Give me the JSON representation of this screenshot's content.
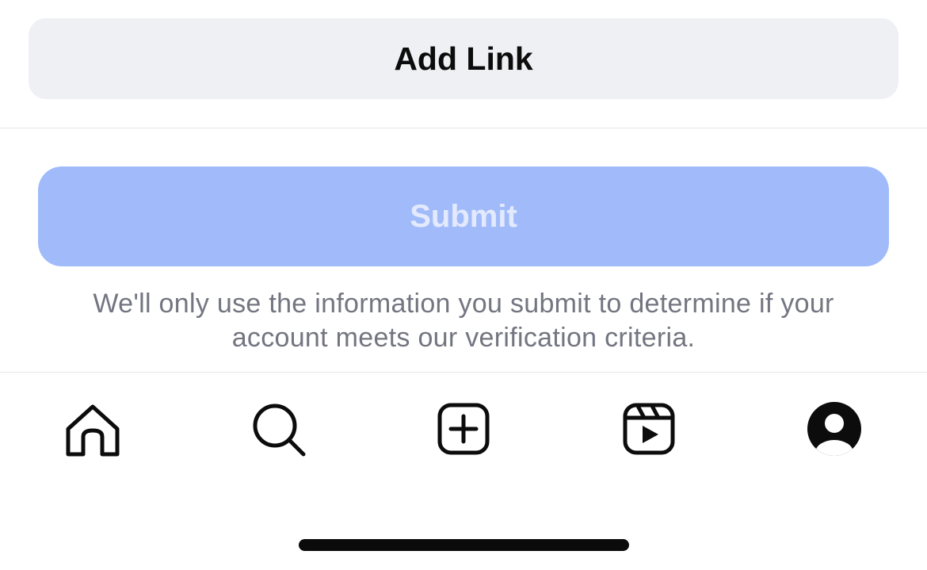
{
  "add_link": {
    "label": "Add Link"
  },
  "submit": {
    "label": "Submit",
    "enabled": false
  },
  "disclaimer": {
    "line1": "We'll only use the information you submit to determine if your",
    "line2": "account meets our verification criteria."
  },
  "tab_bar": {
    "items": [
      {
        "name": "home",
        "icon": "home-icon"
      },
      {
        "name": "search",
        "icon": "search-icon"
      },
      {
        "name": "create",
        "icon": "add-post-icon"
      },
      {
        "name": "reels",
        "icon": "reels-icon"
      },
      {
        "name": "profile",
        "icon": "profile-icon"
      }
    ]
  },
  "colors": {
    "submit_disabled_bg": "#a1bbfa",
    "submit_disabled_text": "#e3eafe",
    "secondary_button_bg": "#eff0f4",
    "muted_text": "#737580",
    "icon": "#0c0c0c"
  }
}
